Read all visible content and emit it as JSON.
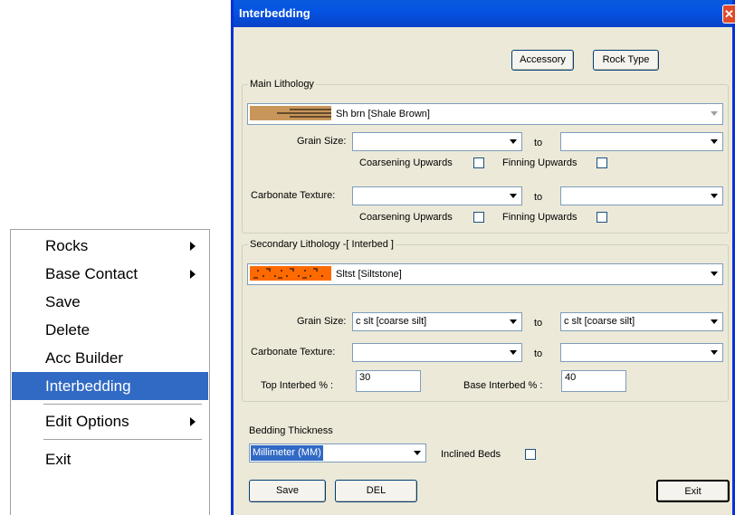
{
  "context_menu": {
    "items": [
      {
        "label": "Rocks",
        "submenu": true
      },
      {
        "label": "Base Contact",
        "submenu": true
      },
      {
        "label": "Save",
        "submenu": false
      },
      {
        "label": "Delete",
        "submenu": false
      },
      {
        "label": "Acc Builder",
        "submenu": false
      },
      {
        "label": "Interbedding",
        "submenu": false,
        "selected": true
      },
      {
        "label": "Edit Options",
        "submenu": true
      },
      {
        "label": "Exit",
        "submenu": false
      }
    ]
  },
  "dialog": {
    "title": "Interbedding",
    "accessory_label": "Accessory",
    "rock_type_label": "Rock Type",
    "main": {
      "group_label": "Main Lithology",
      "lithology_value": "Sh brn [Shale Brown]",
      "lithology_swatch_color": "#c8965a",
      "grain_size_label": "Grain Size:",
      "grain_size_from": "",
      "to_label": "to",
      "grain_size_to": "",
      "coarsening_label": "Coarsening Upwards",
      "finning_label": "Finning Upwards",
      "carbonate_label": "Carbonate Texture:",
      "carbonate_from": "",
      "carbonate_to": ""
    },
    "secondary": {
      "group_label": "Secondary Lithology -[ Interbed ]",
      "lithology_value": "Sltst [Siltstone]",
      "lithology_swatch_color": "#ff6a00",
      "grain_size_label": "Grain Size:",
      "grain_size_from": "c slt  [coarse silt]",
      "to_label": "to",
      "grain_size_to": "c slt  [coarse silt]",
      "carbonate_label": "Carbonate Texture:",
      "carbonate_from": "",
      "carbonate_to": "",
      "top_interbed_label": "Top Interbed % :",
      "top_interbed_value": "30",
      "base_interbed_label": "Base Interbed % :",
      "base_interbed_value": "40"
    },
    "bedding_label": "Bedding Thickness",
    "bedding_value": "Millimeter (MM)",
    "inclined_label": "Inclined Beds",
    "save_label": "Save",
    "del_label": "DEL",
    "exit_label": "Exit"
  }
}
